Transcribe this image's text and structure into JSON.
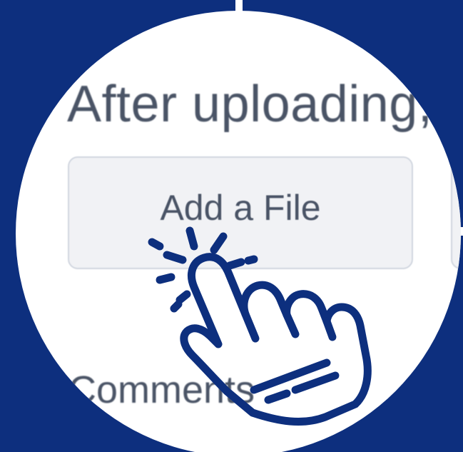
{
  "heading": "After uploading,",
  "add_file_button": "Add a File",
  "comment_label": "Comments",
  "colors": {
    "background": "#0d2f7e",
    "lens": "#ffffff",
    "text": "#4a5466",
    "button_bg": "#f1f2f5",
    "button_border": "#d2d7e0",
    "hand_stroke": "#0d2f7e"
  },
  "icons": {
    "pointer": "tap-hand-icon"
  }
}
